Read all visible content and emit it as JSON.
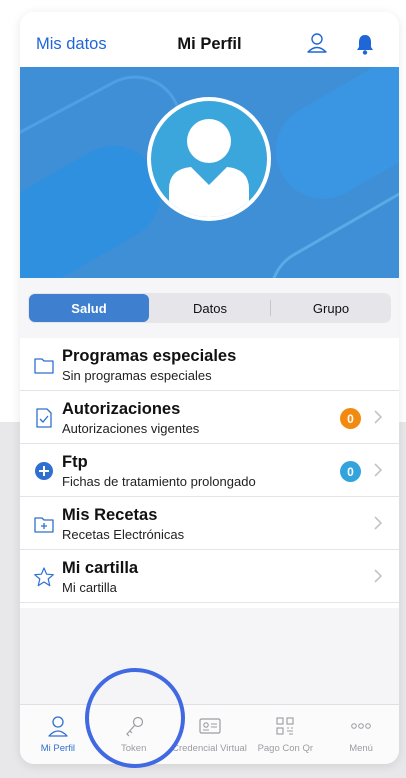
{
  "header": {
    "left_link": "Mis datos",
    "title": "Mi Perfil",
    "user_icon": "user-icon",
    "bell_icon": "bell-icon"
  },
  "tabs": [
    {
      "label": "Salud",
      "active": true
    },
    {
      "label": "Datos",
      "active": false
    },
    {
      "label": "Grupo",
      "active": false
    }
  ],
  "list": [
    {
      "icon": "folder-icon",
      "title": "Programas especiales",
      "subtitle": "Sin programas especiales",
      "badge": null,
      "chevron": false
    },
    {
      "icon": "document-check-icon",
      "title": "Autorizaciones",
      "subtitle": "Autorizaciones vigentes",
      "badge": "0",
      "badge_color": "#f28a10",
      "chevron": true
    },
    {
      "icon": "plus-circle-icon",
      "title": "Ftp",
      "subtitle": "Fichas de tratamiento prolongado",
      "badge": "0",
      "badge_color": "#33a3dc",
      "chevron": true
    },
    {
      "icon": "prescription-folder-icon",
      "title": "Mis Recetas",
      "subtitle": "Recetas Electrónicas",
      "badge": null,
      "chevron": true
    },
    {
      "icon": "star-icon",
      "title": "Mi cartilla",
      "subtitle": "Mi cartilla",
      "badge": null,
      "chevron": true
    }
  ],
  "tabbar": [
    {
      "icon": "user-icon",
      "label": "Mi Perfil",
      "active": true
    },
    {
      "icon": "key-icon",
      "label": "Token",
      "active": false
    },
    {
      "icon": "id-card-icon",
      "label": "Credencial Virtual",
      "active": false
    },
    {
      "icon": "qr-code-icon",
      "label": "Pago Con Qr",
      "active": false
    },
    {
      "icon": "more-icon",
      "label": "Menú",
      "active": false
    }
  ],
  "colors": {
    "accent": "#1f66d6",
    "banner": "#3e8fd6",
    "segment_active": "#3f7fcf",
    "badge_orange": "#f28a10",
    "badge_blue": "#33a3dc",
    "highlight_ring": "#4169e1"
  }
}
